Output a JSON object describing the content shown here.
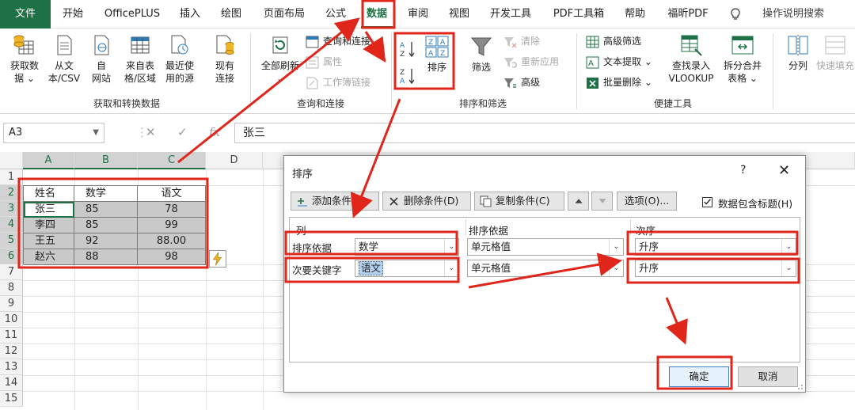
{
  "tabs": [
    {
      "label": "文件"
    },
    {
      "label": "开始"
    },
    {
      "label": "OfficePLUS"
    },
    {
      "label": "插入"
    },
    {
      "label": "绘图"
    },
    {
      "label": "页面布局"
    },
    {
      "label": "公式"
    },
    {
      "label": "数据"
    },
    {
      "label": "审阅"
    },
    {
      "label": "视图"
    },
    {
      "label": "开发工具"
    },
    {
      "label": "PDF工具箱"
    },
    {
      "label": "帮助"
    },
    {
      "label": "福昕PDF"
    }
  ],
  "tell_me": "操作说明搜索",
  "ribbon": {
    "get_data": {
      "line1": "获取数",
      "line2": "据 ⌄"
    },
    "from_text": {
      "line1": "从文",
      "line2": "本/CSV"
    },
    "from_web": {
      "line1": "自",
      "line2": "网站"
    },
    "from_table": {
      "line1": "来自表",
      "line2": "格/区域"
    },
    "recent_sources": {
      "line1": "最近使",
      "line2": "用的源"
    },
    "existing_conn": {
      "line1": "现有",
      "line2": "连接"
    },
    "group1_label": "获取和转换数据",
    "refresh_all": {
      "line1": "全部刷新",
      "line2": "⌄"
    },
    "queries_conn": "查询和连接",
    "properties": "属性",
    "edit_links": "工作簿链接",
    "group2_label": "查询和连接",
    "sort_label": "排序",
    "filter_label": "筛选",
    "clear": "清除",
    "reapply": "重新应用",
    "advanced": "高级",
    "group3_label": "排序和筛选",
    "adv_filter": "高级筛选",
    "text_extract": "文本提取 ⌄",
    "batch_delete": "批量删除 ⌄",
    "vlookup": {
      "line1": "查找录入",
      "line2": "VLOOKUP"
    },
    "split_merge": {
      "line1": "拆分合并",
      "line2": "表格 ⌄"
    },
    "group4_label": "便捷工具",
    "text_to_cols": "分列",
    "flash_fill": "快速填充"
  },
  "formula_bar": {
    "name_box": "A3",
    "fx": "fx",
    "content": "张三"
  },
  "grid": {
    "columns": [
      "A",
      "B",
      "C",
      "D"
    ],
    "rows": [
      "1",
      "2",
      "3",
      "4",
      "5",
      "6",
      "7",
      "8",
      "9",
      "10",
      "11",
      "12",
      "13",
      "14",
      "15"
    ],
    "header": [
      "姓名",
      "数学",
      "语文"
    ],
    "data": [
      [
        "张三",
        "85",
        "78"
      ],
      [
        "李四",
        "85",
        "99"
      ],
      [
        "王五",
        "92",
        "88.00"
      ],
      [
        "赵六",
        "88",
        "98"
      ]
    ]
  },
  "dialog": {
    "title": "排序",
    "help": "?",
    "close": "✕",
    "add_level": "添加条件(A)",
    "delete_level": "删除条件(D)",
    "copy_level": "复制条件(C)",
    "options": "选项(O)...",
    "has_headers": "数据包含标题(H)",
    "has_headers_checked": true,
    "col_header": "列",
    "sort_on_header": "排序依据",
    "order_header": "次序",
    "levels": [
      {
        "label": "排序依据",
        "column": "数学",
        "sort_on": "单元格值",
        "order": "升序"
      },
      {
        "label": "次要关键字",
        "column": "语文",
        "sort_on": "单元格值",
        "order": "升序"
      }
    ],
    "ok": "确定",
    "cancel": "取消"
  },
  "colors": {
    "excel_green": "#1e7145",
    "annotation_red": "#e0251b"
  }
}
